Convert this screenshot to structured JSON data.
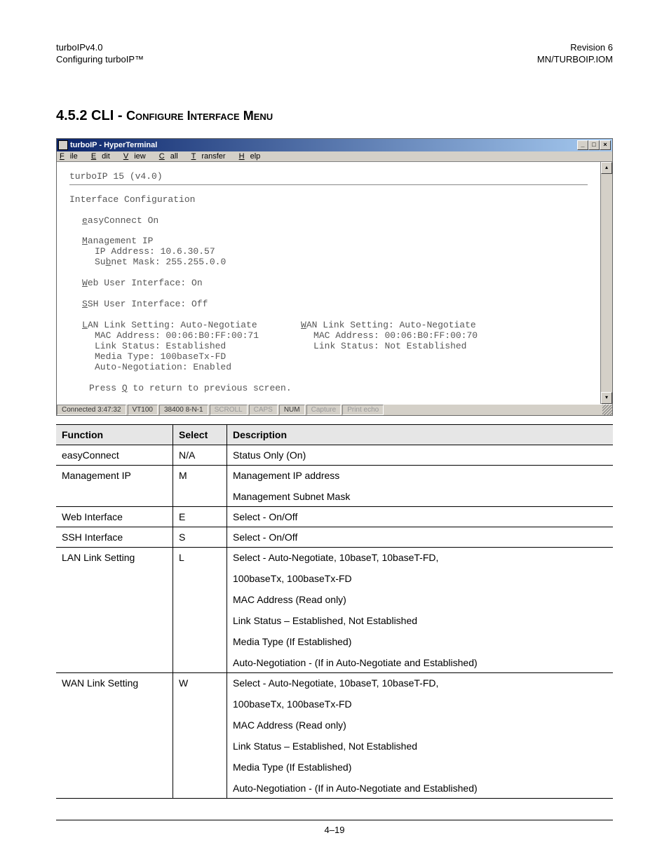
{
  "header": {
    "left1": "turboIPv4.0",
    "left2": "Configuring turboIP™",
    "right1": "Revision 6",
    "right2": "MN/TURBOIP.IOM"
  },
  "section": {
    "number": "4.5.2",
    "cli": "CLI",
    "dash": " - ",
    "rest": "Configure Interface Menu"
  },
  "hyperterm": {
    "title": "turboIP - HyperTerminal",
    "min": "_",
    "max": "□",
    "close": "×",
    "menu_file_u": "F",
    "menu_file_r": "ile",
    "menu_edit_u": "E",
    "menu_edit_r": "dit",
    "menu_view_u": "V",
    "menu_view_r": "iew",
    "menu_call_u": "C",
    "menu_call_r": "all",
    "menu_transfer_u": "T",
    "menu_transfer_r": "ransfer",
    "menu_help_u": "H",
    "menu_help_r": "elp",
    "sb_up": "▴",
    "sb_dn": "▾",
    "body": {
      "line1": "turboIP 15 (v4.0)",
      "line2": "Interface Configuration",
      "ec_u": "e",
      "ec_r": "asyConnect On",
      "mip_u": "M",
      "mip_r": "anagement IP",
      "mip_ip": "IP Address: 10.6.30.57",
      "mip_sn_a": "Su",
      "mip_sn_u": "b",
      "mip_sn_b": "net Mask: 255.255.0.0",
      "wui_u": "W",
      "wui_r": "eb User Interface: On",
      "ssh_u": "S",
      "ssh_r": "SH User Interface: Off",
      "lan_u": "L",
      "lan_r": "AN Link Setting: Auto-Negotiate",
      "lan_mac": "MAC Address: 00:06:B0:FF:00:71",
      "lan_ls": "Link Status: Established",
      "lan_mt": "Media Type: 100baseTx-FD",
      "lan_an": "Auto-Negotiation: Enabled",
      "wan_u": "W",
      "wan_r": "AN Link Setting: Auto-Negotiate",
      "wan_mac": "MAC Address: 00:06:B0:FF:00:70",
      "wan_ls": "Link Status: Not Established",
      "press_a": "Press ",
      "press_u": "Q",
      "press_b": " to return to previous screen."
    },
    "status": {
      "conn": "Connected 3:47:32",
      "term": "VT100",
      "baud": "38400 8-N-1",
      "scroll": "SCROLL",
      "caps": "CAPS",
      "num": "NUM",
      "capture": "Capture",
      "echo": "Print echo"
    }
  },
  "table": {
    "h1": "Function",
    "h2": "Select",
    "h3": "Description",
    "rows": [
      {
        "f": "easyConnect",
        "s": "N/A",
        "d": [
          "Status Only (On)"
        ]
      },
      {
        "f": "Management IP",
        "s": "M",
        "d": [
          "Management IP address",
          "Management Subnet Mask"
        ]
      },
      {
        "f": "Web Interface",
        "s": "E",
        "d": [
          "Select - On/Off"
        ]
      },
      {
        "f": "SSH Interface",
        "s": "S",
        "d": [
          "Select - On/Off"
        ]
      },
      {
        "f": "LAN Link Setting",
        "s": "L",
        "d": [
          "Select - Auto-Negotiate, 10baseT, 10baseT-FD,",
          "100baseTx, 100baseTx-FD",
          "MAC Address (Read only)",
          "Link Status – Established, Not Established",
          "Media Type (If Established)",
          "Auto-Negotiation - (If in Auto-Negotiate and Established)"
        ]
      },
      {
        "f": "WAN Link Setting",
        "s": "W",
        "d": [
          "Select - Auto-Negotiate, 10baseT, 10baseT-FD,",
          "100baseTx, 100baseTx-FD",
          "MAC Address (Read only)",
          "Link Status – Established, Not Established",
          "Media Type (If Established)",
          "Auto-Negotiation - (If in Auto-Negotiate and Established)"
        ]
      }
    ]
  },
  "pagenum": "4–19"
}
